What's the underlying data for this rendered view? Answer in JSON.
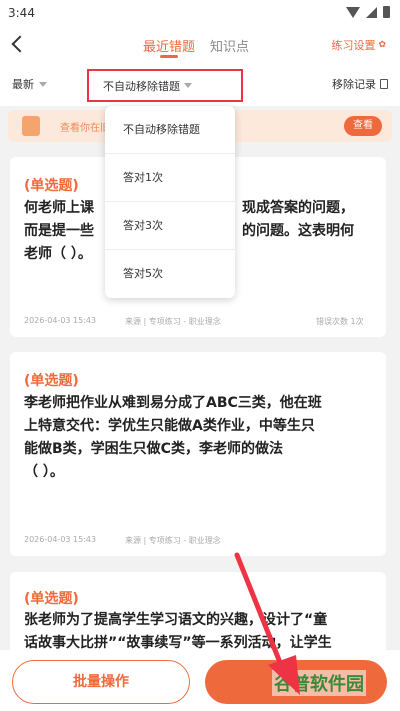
{
  "status_bar": {
    "time": "3:44"
  },
  "nav": {
    "tabs": [
      {
        "label": "最近错题",
        "active": true
      },
      {
        "label": "知识点",
        "active": false
      }
    ],
    "practice_settings": "练习设置"
  },
  "filters": {
    "sort_label": "最新",
    "auto_remove_value": "不自动移除错题",
    "remove_history": "移除记录"
  },
  "banner": {
    "text": "查看你在旧",
    "view_button": "查看"
  },
  "dropdown": {
    "options": [
      "不自动移除错题",
      "答对1次",
      "答对3次",
      "答对5次"
    ]
  },
  "questions": [
    {
      "type": "(单选题)",
      "lines": [
        "何老师上课",
        "而是提一些",
        "老师（ ）。"
      ],
      "lines_right": [
        "现成答案的问题，",
        "的问题。这表明何"
      ],
      "date": "2026-04-03 15:43",
      "source": "来源 | 专项练习 - 职业理念",
      "errors": "错误次数 1次"
    },
    {
      "type": "(单选题)",
      "lines": [
        "李老师把作业从难到易分成了ABC三类，他在班",
        "上特意交代：学优生只能做A类作业，中等生只",
        "能做B类，学困生只做C类，李老师的做法",
        "（ ）。"
      ],
      "date": "2026-04-03 15:43",
      "source": "来源 | 专项练习 - 职业理念"
    },
    {
      "type": "(单选题)",
      "lines": [
        "张老师为了提高学生学习语文的兴趣，设计了“童",
        "话故事大比拼”“故事续写”等一系列活动，让学生"
      ]
    }
  ],
  "bottom": {
    "batch_label": "批量操作",
    "watermark": "谷普软件园"
  },
  "colors": {
    "accent": "#ee6a3c",
    "highlight_box": "#ee3344",
    "arrow": "#ee3344"
  }
}
